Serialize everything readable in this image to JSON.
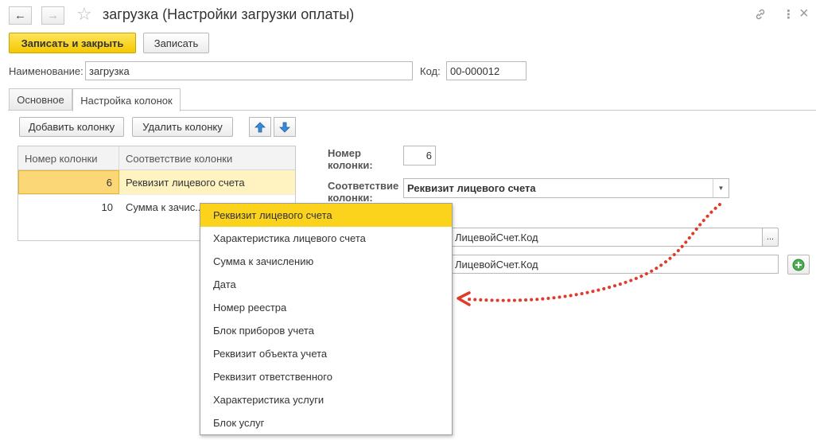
{
  "window": {
    "title": "загрузка (Настройки загрузки оплаты)",
    "back_icon": "←",
    "forward_icon": "→",
    "star_icon": "☆",
    "link_icon": "🔗",
    "more_icon": "⋮",
    "close_icon": "×"
  },
  "toolbar": {
    "save_close_label": "Записать и закрыть",
    "save_label": "Записать"
  },
  "header_fields": {
    "name_label": "Наименование:",
    "name_value": "загрузка",
    "code_label": "Код:",
    "code_value": "00-000012"
  },
  "tabs": [
    {
      "label": "Основное",
      "active": false
    },
    {
      "label": "Настройка колонок",
      "active": true
    }
  ],
  "columns_toolbar": {
    "add_label": "Добавить колонку",
    "delete_label": "Удалить колонку"
  },
  "table": {
    "headers": [
      "Номер колонки",
      "Соответствие колонки"
    ],
    "rows": [
      {
        "number": "6",
        "mapping": "Реквизит лицевого счета",
        "selected": true
      },
      {
        "number": "10",
        "mapping": "Сумма к зачис...",
        "selected": false
      }
    ]
  },
  "detail": {
    "number_label_1": "Номер",
    "number_label_2": "колонки:",
    "number_value": "6",
    "mapping_label_1": "Соответствие",
    "mapping_label_2": "колонки:",
    "mapping_value": "Реквизит лицевого счета",
    "field1_value": "ЛицевойСчет.Код",
    "field1_button": "...",
    "field2_value": "ЛицевойСчет.Код",
    "add_icon": "+"
  },
  "dropdown": {
    "items": [
      "Реквизит лицевого счета",
      "Характеристика лицевого счета",
      "Сумма к зачислению",
      "Дата",
      "Номер реестра",
      "Блок приборов учета",
      "Реквизит объекта учета",
      "Реквизит ответственного",
      "Характеристика услуги",
      "Блок услуг"
    ],
    "selected_index": 0
  },
  "colors": {
    "accent": "#fbd21c",
    "selected_row": "#fff3c2",
    "annotation_arrow": "#e03a2a",
    "add_button": "#4caf50"
  }
}
